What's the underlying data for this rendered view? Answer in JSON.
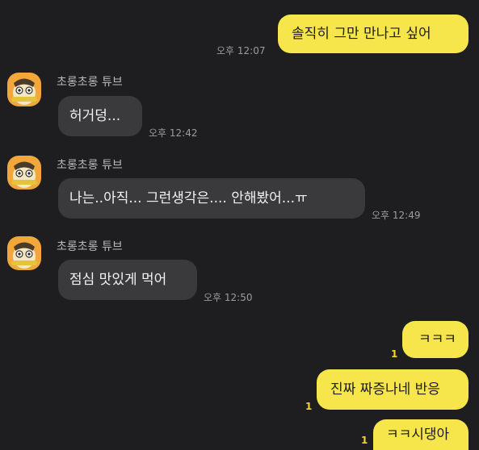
{
  "colors": {
    "background": "#1e1e20",
    "my_bubble": "#f7e64b",
    "their_bubble": "#3a3a3c",
    "unread_count": "#f2d332",
    "avatar_bg": "#f2a73b"
  },
  "messages": [
    {
      "from": "me",
      "text": "솔직히 그만 만나고 싶어",
      "time": "오후 12:07"
    },
    {
      "from": "them",
      "sender": "초롱초롱 튜브",
      "avatar_icon": "tube-character-icon",
      "text": "허거덩...",
      "time": "오후 12:42"
    },
    {
      "from": "them",
      "sender": "초롱초롱 튜브",
      "avatar_icon": "tube-character-icon",
      "text": "나는..아직... 그런생각은.... 안해봤어...ㅠ",
      "time": "오후 12:49"
    },
    {
      "from": "them",
      "sender": "초롱초롱 튜브",
      "avatar_icon": "tube-character-icon",
      "text": "점심 맛있게 먹어",
      "time": "오후 12:50"
    },
    {
      "from": "me",
      "text": "ㅋㅋㅋ",
      "unread": "1"
    },
    {
      "from": "me",
      "text": "진짜 짜증나네 반응",
      "unread": "1"
    },
    {
      "from": "me",
      "text": "ㅋㅋ시댕아",
      "unread": "1"
    }
  ]
}
